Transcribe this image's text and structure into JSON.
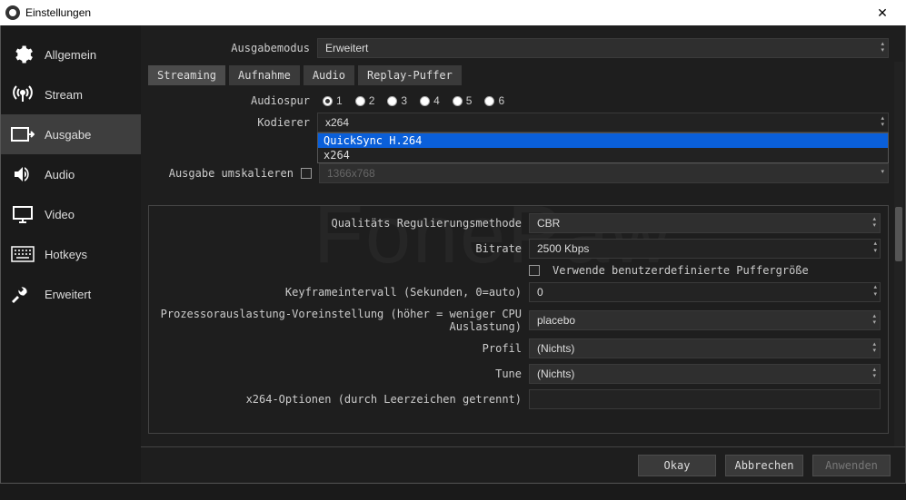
{
  "title": "Einstellungen",
  "sidebar": {
    "items": [
      {
        "label": "Allgemein"
      },
      {
        "label": "Stream"
      },
      {
        "label": "Ausgabe"
      },
      {
        "label": "Audio"
      },
      {
        "label": "Video"
      },
      {
        "label": "Hotkeys"
      },
      {
        "label": "Erweitert"
      }
    ]
  },
  "mode": {
    "label": "Ausgabemodus",
    "value": "Erweitert"
  },
  "tabs": [
    "Streaming",
    "Aufnahme",
    "Audio",
    "Replay-Puffer"
  ],
  "audiotrack": {
    "label": "Audiospur",
    "options": [
      "1",
      "2",
      "3",
      "4",
      "5",
      "6"
    ],
    "selected": "1"
  },
  "encoder": {
    "label": "Kodierer",
    "value": "x264",
    "menu": [
      "QuickSync H.264",
      "x264"
    ]
  },
  "rescale": {
    "label": "Ausgabe umskalieren",
    "value": "1366x768"
  },
  "quality": {
    "label": "Qualitäts Regulierungsmethode",
    "value": "CBR"
  },
  "bitrate": {
    "label": "Bitrate",
    "value": "2500 Kbps"
  },
  "custombuffer": {
    "label": "Verwende benutzerdefinierte Puffergröße"
  },
  "keyframe": {
    "label": "Keyframeintervall (Sekunden, 0=auto)",
    "value": "0"
  },
  "preset": {
    "label": "Prozessorauslastung-Voreinstellung (höher = weniger CPU Auslastung)",
    "value": "placebo"
  },
  "profile": {
    "label": "Profil",
    "value": "(Nichts)"
  },
  "tune": {
    "label": "Tune",
    "value": "(Nichts)"
  },
  "x264opts": {
    "label": "x264-Optionen (durch Leerzeichen getrennt)",
    "value": ""
  },
  "buttons": {
    "ok": "Okay",
    "cancel": "Abbrechen",
    "apply": "Anwenden"
  },
  "watermark": "FonePaw"
}
